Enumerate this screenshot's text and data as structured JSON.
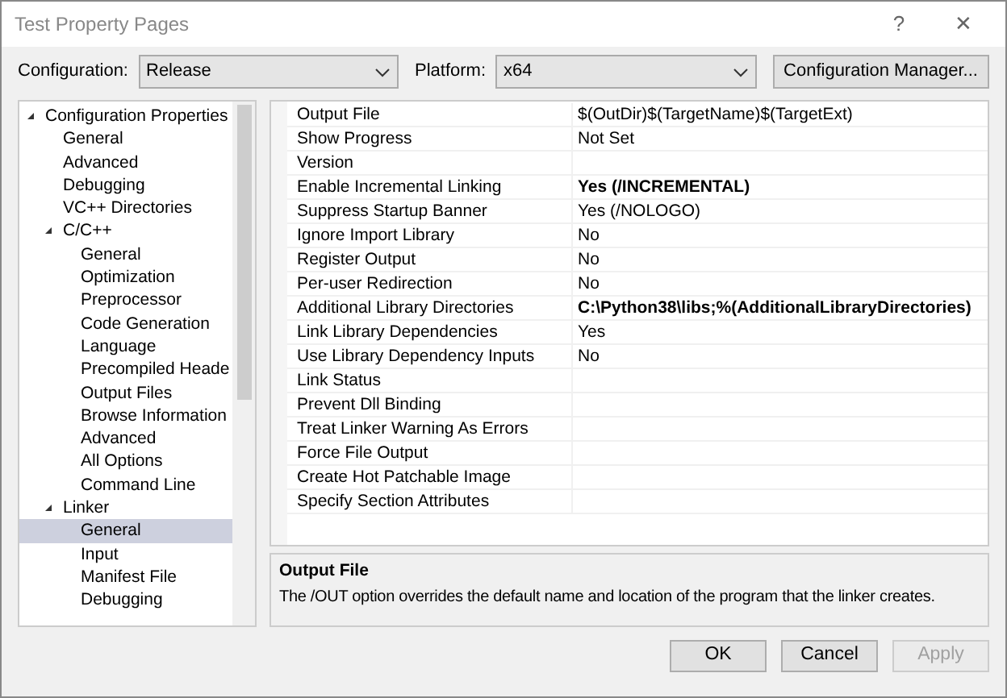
{
  "window": {
    "title": "Test Property Pages",
    "help": "?",
    "close": "✕"
  },
  "toolbar": {
    "configuration_label": "Configuration:",
    "configuration": "Release",
    "platform_label": "Platform:",
    "platform": "x64",
    "manager_button": "Configuration Manager..."
  },
  "tree": [
    {
      "label": "Configuration Properties",
      "expanded": true,
      "selected": false,
      "children": [
        {
          "label": "General",
          "selected": false
        },
        {
          "label": "Advanced",
          "selected": false
        },
        {
          "label": "Debugging",
          "selected": false
        },
        {
          "label": "VC++ Directories",
          "selected": false
        },
        {
          "label": "C/C++",
          "expanded": true,
          "selected": false,
          "children": [
            {
              "label": "General",
              "selected": false
            },
            {
              "label": "Optimization",
              "selected": false
            },
            {
              "label": "Preprocessor",
              "selected": false
            },
            {
              "label": "Code Generation",
              "selected": false
            },
            {
              "label": "Language",
              "selected": false
            },
            {
              "label": "Precompiled Heade",
              "selected": false
            },
            {
              "label": "Output Files",
              "selected": false
            },
            {
              "label": "Browse Information",
              "selected": false
            },
            {
              "label": "Advanced",
              "selected": false
            },
            {
              "label": "All Options",
              "selected": false
            },
            {
              "label": "Command Line",
              "selected": false
            }
          ]
        },
        {
          "label": "Linker",
          "expanded": true,
          "selected": false,
          "children": [
            {
              "label": "General",
              "selected": true
            },
            {
              "label": "Input",
              "selected": false
            },
            {
              "label": "Manifest File",
              "selected": false
            },
            {
              "label": "Debugging",
              "selected": false
            }
          ]
        }
      ]
    }
  ],
  "properties": [
    {
      "name": "Output File",
      "value": "$(OutDir)$(TargetName)$(TargetExt)",
      "bold": false
    },
    {
      "name": "Show Progress",
      "value": "Not Set",
      "bold": false
    },
    {
      "name": "Version"
    },
    {
      "name": "Enable Incremental Linking",
      "value": "Yes (/INCREMENTAL)",
      "bold": true
    },
    {
      "name": "Suppress Startup Banner",
      "value": "Yes (/NOLOGO)",
      "bold": false
    },
    {
      "name": "Ignore Import Library",
      "value": "No",
      "bold": false
    },
    {
      "name": "Register Output",
      "value": "No",
      "bold": false
    },
    {
      "name": "Per-user Redirection",
      "value": "No",
      "bold": false
    },
    {
      "name": "Additional Library Directories",
      "value": "C:\\Python38\\libs;%(AdditionalLibraryDirectories)",
      "bold": true
    },
    {
      "name": "Link Library Dependencies",
      "value": "Yes",
      "bold": false
    },
    {
      "name": "Use Library Dependency Inputs",
      "value": "No",
      "bold": false
    },
    {
      "name": "Link Status"
    },
    {
      "name": "Prevent Dll Binding"
    },
    {
      "name": "Treat Linker Warning As Errors"
    },
    {
      "name": "Force File Output"
    },
    {
      "name": "Create Hot Patchable Image"
    },
    {
      "name": "Specify Section Attributes"
    }
  ],
  "description": {
    "title": "Output File",
    "text": "The /OUT option overrides the default name and location of the program that the linker creates."
  },
  "buttons": [
    {
      "label": "OK",
      "disabled": false
    },
    {
      "label": "Cancel",
      "disabled": false
    },
    {
      "label": "Apply",
      "disabled": true
    }
  ]
}
